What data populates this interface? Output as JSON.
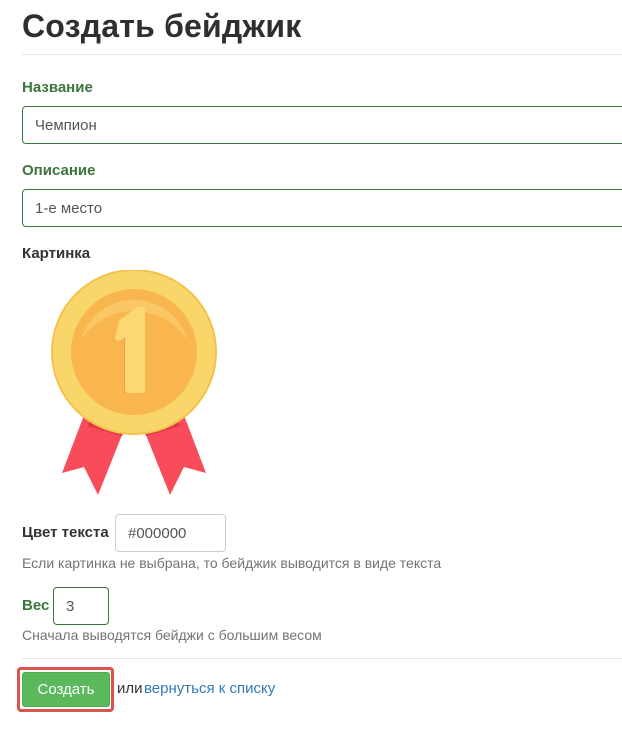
{
  "page": {
    "title": "Создать бейджик"
  },
  "form": {
    "name": {
      "label": "Название",
      "value": "Чемпион"
    },
    "description": {
      "label": "Описание",
      "value": "1-е место"
    },
    "image": {
      "label": "Картинка",
      "icon": "gold-medal-icon",
      "digit": "1",
      "colors": {
        "medal_outer": "#f8d66a",
        "medal_inner": "#f9b64f",
        "ribbon": "#f94c5a"
      }
    },
    "text_color": {
      "label": "Цвет текста",
      "value": "#000000",
      "help": "Если картинка не выбрана, то бейджик выводится в виде текста"
    },
    "weight": {
      "label": "Вес",
      "value": "3",
      "help": "Сначала выводятся бейджи с большим весом"
    }
  },
  "actions": {
    "create_label": "Создать",
    "or_text": "или",
    "back_link_label": "вернуться к списку"
  },
  "colors": {
    "success_green": "#3c763d",
    "button_green": "#5cb85c",
    "link_blue": "#337ab7",
    "highlight_red": "#d9534f"
  }
}
